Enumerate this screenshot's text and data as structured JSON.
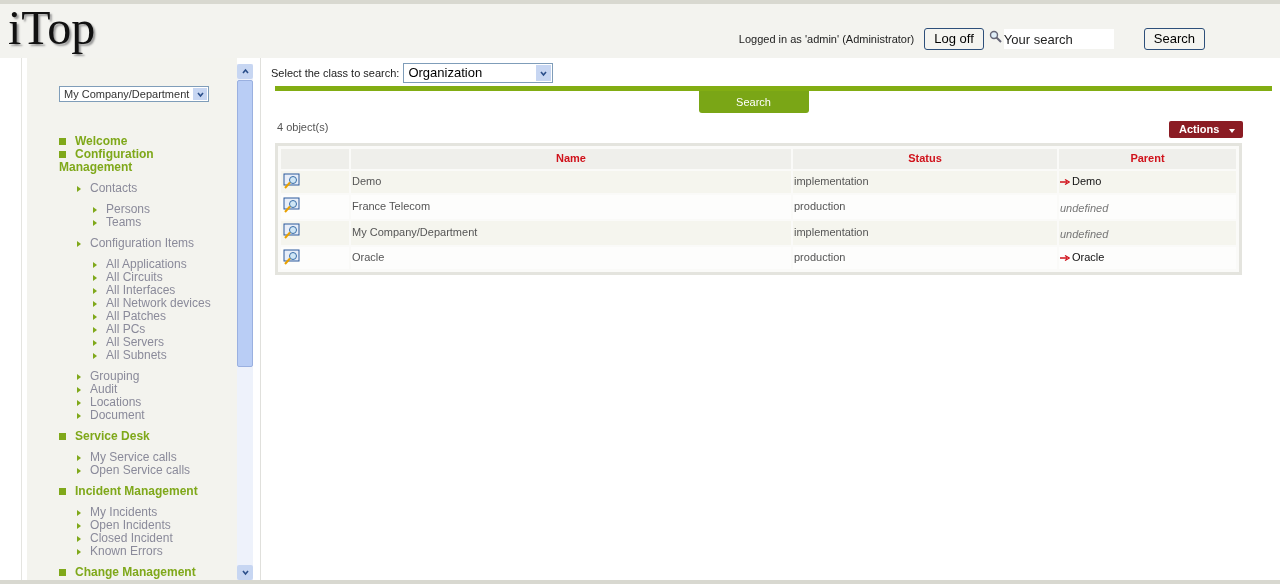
{
  "header": {
    "logo": "iTop",
    "login_text": "Logged in as 'admin' (Administrator)",
    "logoff_button": "Log off",
    "search_placeholder": "Your search",
    "search_button": "Search"
  },
  "sidebar": {
    "organization_select": "My Company/Department",
    "sections": [
      {
        "label": "Welcome"
      },
      {
        "label": "Configuration Management",
        "children": [
          {
            "label": "Contacts",
            "children": [
              {
                "label": "Persons"
              },
              {
                "label": "Teams"
              }
            ]
          },
          {
            "label": "Configuration Items",
            "children": [
              {
                "label": "All Applications"
              },
              {
                "label": "All Circuits"
              },
              {
                "label": "All Interfaces"
              },
              {
                "label": "All Network devices"
              },
              {
                "label": "All Patches"
              },
              {
                "label": "All PCs"
              },
              {
                "label": "All Servers"
              },
              {
                "label": "All Subnets"
              }
            ]
          },
          {
            "label": "Grouping"
          },
          {
            "label": "Audit"
          },
          {
            "label": "Locations"
          },
          {
            "label": "Document"
          }
        ]
      },
      {
        "label": "Service Desk",
        "children": [
          {
            "label": "My Service calls"
          },
          {
            "label": "Open Service calls"
          }
        ]
      },
      {
        "label": "Incident Management",
        "children": [
          {
            "label": "My Incidents"
          },
          {
            "label": "Open Incidents"
          },
          {
            "label": "Closed Incident"
          },
          {
            "label": "Known Errors"
          }
        ]
      },
      {
        "label": "Change Management"
      }
    ]
  },
  "search_form": {
    "class_label": "Select the class to search:",
    "class_value": "Organization",
    "tab": "Search"
  },
  "results": {
    "count": "4 object(s)",
    "actions_button": "Actions",
    "columns": [
      "Name",
      "Status",
      "Parent"
    ],
    "rows": [
      {
        "name": "Demo",
        "status": "implementation",
        "parent": {
          "kind": "link",
          "text": "Demo"
        }
      },
      {
        "name": "France Telecom",
        "status": "production",
        "parent": {
          "kind": "undefined",
          "text": "undefined"
        }
      },
      {
        "name": "My Company/Department",
        "status": "implementation",
        "parent": {
          "kind": "undefined",
          "text": "undefined"
        }
      },
      {
        "name": "Oracle",
        "status": "production",
        "parent": {
          "kind": "link",
          "text": "Oracle"
        }
      }
    ]
  }
}
